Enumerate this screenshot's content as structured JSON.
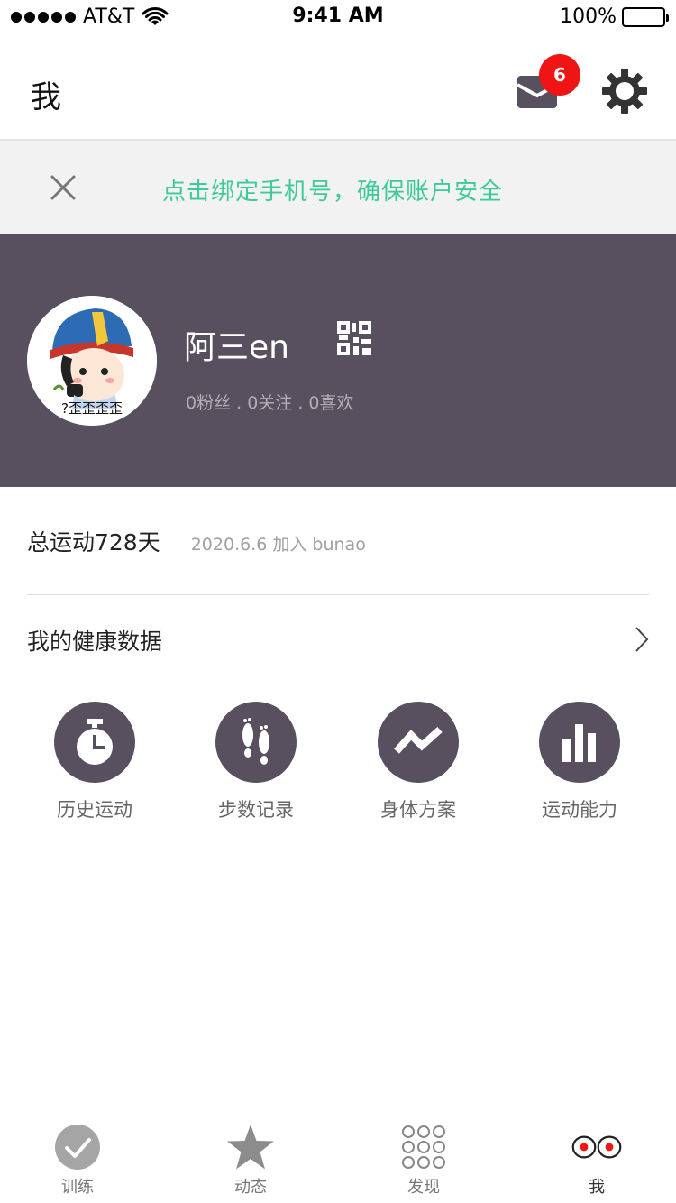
{
  "status_bar": {
    "carrier": "AT&T",
    "time": "9:41 AM",
    "battery": "100%"
  },
  "header": {
    "title": "我",
    "unread_count": "6"
  },
  "banner": {
    "text": "点击绑定手机号，确保账户安全"
  },
  "profile": {
    "username": "阿三en",
    "stats": "0粉丝 . 0关注 . 0喜欢",
    "avatar_caption": "?歪歪歪歪"
  },
  "summary": {
    "total_days": "总运动728天",
    "join_info": "2020.6.6  加入  bunao"
  },
  "health": {
    "title": "我的健康数据",
    "items": [
      {
        "label": "历史运动",
        "icon": "stopwatch-icon"
      },
      {
        "label": "步数记录",
        "icon": "footprints-icon"
      },
      {
        "label": "身体方案",
        "icon": "trend-line-icon"
      },
      {
        "label": "运动能力",
        "icon": "bar-chart-icon"
      }
    ]
  },
  "tabs": [
    {
      "label": "训练",
      "icon": "check-circle-icon",
      "active": false
    },
    {
      "label": "动态",
      "icon": "star-icon",
      "active": false
    },
    {
      "label": "发现",
      "icon": "grid-dots-icon",
      "active": false
    },
    {
      "label": "我",
      "icon": "eyes-icon",
      "active": true
    }
  ],
  "colors": {
    "accent_green": "#3ec99a",
    "profile_bg": "#58505e",
    "badge_red": "#f01414",
    "tab_active_red": "#f01414"
  }
}
